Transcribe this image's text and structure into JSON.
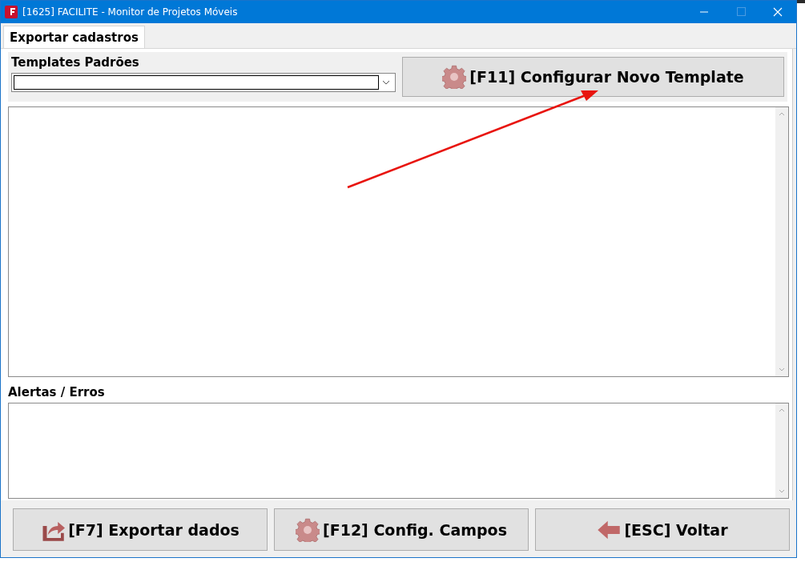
{
  "window": {
    "title": "[1625] FACILITE - Monitor de Projetos Móveis"
  },
  "tabs": [
    {
      "label": "Exportar cadastros",
      "selected": true
    }
  ],
  "templates": {
    "label": "Templates Padrões",
    "action": {
      "label": "[F11] Configurar Novo Template",
      "kind": "gear"
    }
  },
  "alerts": {
    "label": "Alertas / Erros"
  },
  "buttons": [
    {
      "label": "[F7] Exportar dados",
      "kind": "export"
    },
    {
      "label": "[F12] Config. Campos",
      "kind": "gear"
    },
    {
      "label": "[ESC] Voltar",
      "kind": "back"
    }
  ]
}
